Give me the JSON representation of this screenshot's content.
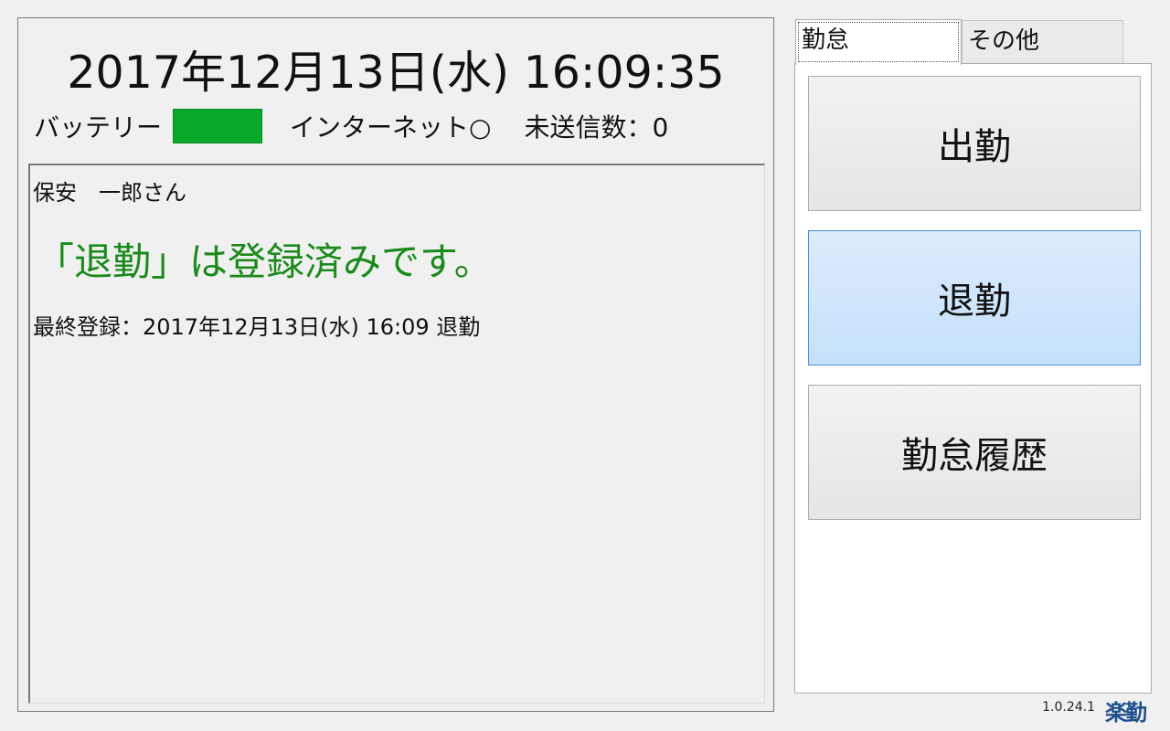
{
  "clock": {
    "text": "2017年12月13日(水) 16:09:35"
  },
  "status": {
    "battery_label": "バッテリー",
    "battery_color": "#0aa82a",
    "internet_label": "インターネット○",
    "unsent_label": "未送信数：0"
  },
  "message": {
    "user_name": "保安　一郎さん",
    "registered_text": "「退勤」は登録済みです。",
    "registered_color": "#1a8a1a",
    "last_registration": "最終登録：2017年12月13日(水) 16:09 退勤"
  },
  "tabs": [
    {
      "label": "勤怠",
      "active": true
    },
    {
      "label": "その他",
      "active": false
    }
  ],
  "buttons": {
    "clock_in": "出勤",
    "clock_out": "退勤",
    "history": "勤怠履歴"
  },
  "footer": {
    "version": "1.0.24.1",
    "logo": "楽勤"
  }
}
